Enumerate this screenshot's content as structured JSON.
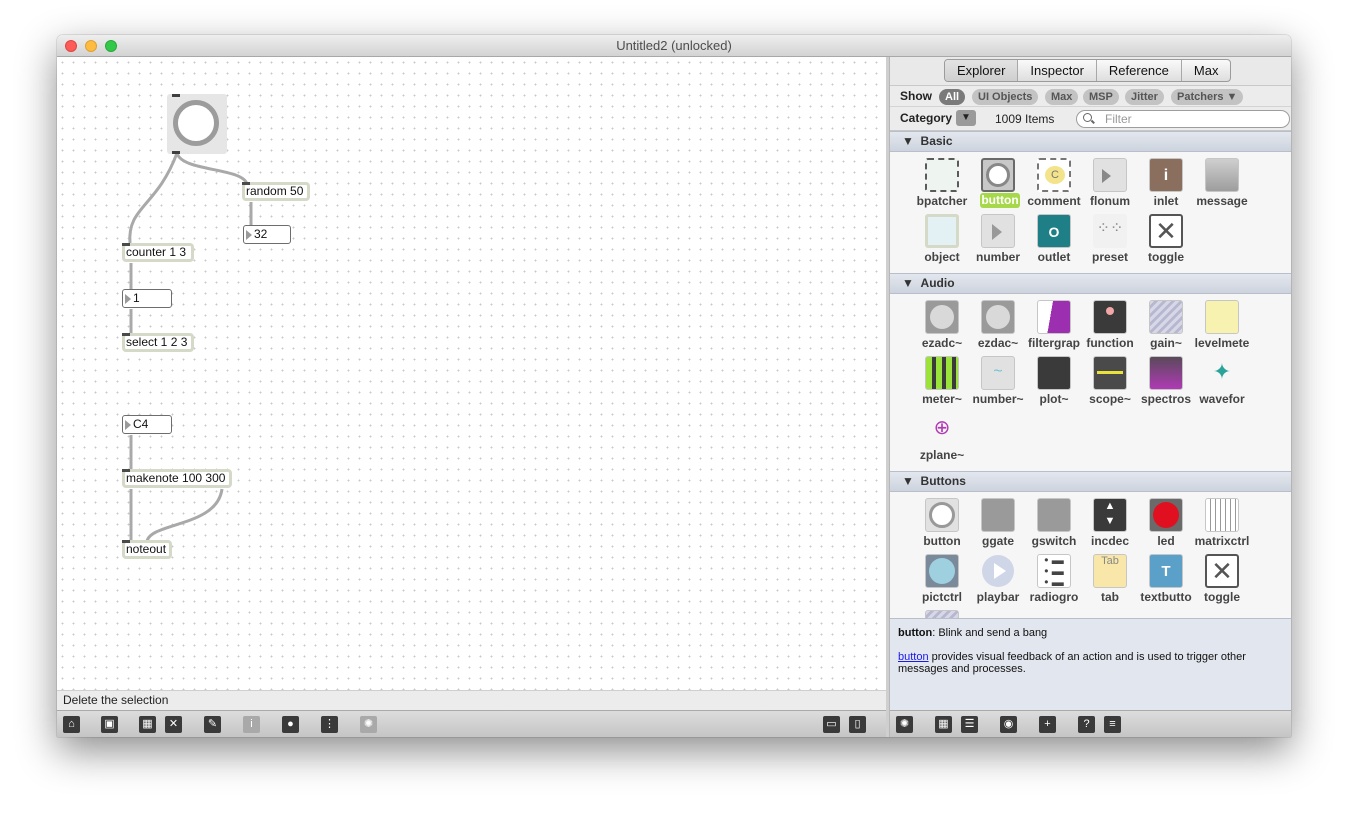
{
  "window": {
    "title": "Untitled2 (unlocked)"
  },
  "patcher": {
    "objects": {
      "random": "random 50",
      "random_out": "32",
      "counter": "counter 1 3",
      "counter_out": "1",
      "select": "select 1 2 3",
      "note": "C4",
      "makenote": "makenote 100 300",
      "noteout": "noteout"
    },
    "status": "Delete the selection"
  },
  "patcher_toolbar": {
    "icons": [
      "lock-icon",
      "new-object-icon",
      "presentation-icon",
      "clear-icon",
      "paint-icon",
      "info-icon",
      "slider-icon",
      "grid-icon",
      "debug-icon",
      "view-icon-1",
      "view-icon-2"
    ]
  },
  "sidebar": {
    "tabs": [
      "Explorer",
      "Inspector",
      "Reference",
      "Max"
    ],
    "active_tab": "Explorer",
    "show_label": "Show",
    "filters": [
      "All",
      "UI Objects",
      "Max",
      "MSP",
      "Jitter",
      "Patchers ▼"
    ],
    "active_filter": "All",
    "category_label": "Category",
    "category_dropdown": "▼",
    "item_count": "1009 Items",
    "filter_placeholder": "Filter",
    "sections": [
      {
        "name": "Basic",
        "items": [
          "bpatcher",
          "button",
          "comment",
          "flonum",
          "inlet",
          "message",
          "object",
          "number",
          "outlet",
          "preset",
          "toggle"
        ]
      },
      {
        "name": "Audio",
        "items": [
          "ezadc~",
          "ezdac~",
          "filtergrap",
          "function",
          "gain~",
          "levelmete",
          "meter~",
          "number~",
          "plot~",
          "scope~",
          "spectros",
          "wavefor",
          "zplane~"
        ]
      },
      {
        "name": "Buttons",
        "items": [
          "button",
          "ggate",
          "gswitch",
          "incdec",
          "led",
          "matrixctrl",
          "pictctrl",
          "playbar",
          "radiogro",
          "tab",
          "textbutto",
          "toggle"
        ]
      }
    ],
    "selected_item": "button",
    "description": {
      "name": "button",
      "short": ": Blink and send a bang",
      "link": "button",
      "long": " provides visual feedback of an action and is used to trigger other messages and processes."
    }
  },
  "colors": {
    "selected_label": "#a6d84a",
    "section_header": "#d3d9e3",
    "object_border": "#d5d9c8"
  }
}
